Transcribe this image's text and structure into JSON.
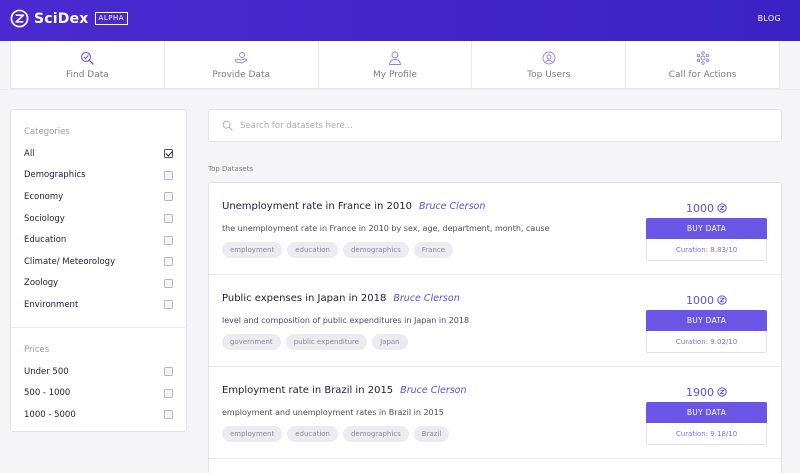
{
  "brand": {
    "name": "SciDex",
    "badge": "ALPHA"
  },
  "header": {
    "blog_link": "BLOG"
  },
  "nav": {
    "items": [
      {
        "label": "Find Data",
        "icon": "find-data-icon"
      },
      {
        "label": "Provide Data",
        "icon": "provide-data-icon"
      },
      {
        "label": "My Profile",
        "icon": "profile-icon"
      },
      {
        "label": "Top Users",
        "icon": "top-users-icon"
      },
      {
        "label": "Call for Actions",
        "icon": "call-for-actions-icon"
      }
    ]
  },
  "sidebar": {
    "categories": {
      "heading": "Categories",
      "items": [
        {
          "label": "All",
          "checked": true
        },
        {
          "label": "Demographics",
          "checked": false
        },
        {
          "label": "Economy",
          "checked": false
        },
        {
          "label": "Sociology",
          "checked": false
        },
        {
          "label": "Education",
          "checked": false
        },
        {
          "label": "Climate/ Meteorology",
          "checked": false
        },
        {
          "label": "Zoology",
          "checked": false
        },
        {
          "label": "Environment",
          "checked": false
        }
      ]
    },
    "prices": {
      "heading": "Prices",
      "items": [
        {
          "label": "Under 500",
          "checked": false
        },
        {
          "label": "500 - 1000",
          "checked": false
        },
        {
          "label": "1000 - 5000",
          "checked": false
        }
      ]
    }
  },
  "search": {
    "placeholder": "Search for datasets here...",
    "value": ""
  },
  "main": {
    "section_title": "Top Datasets"
  },
  "datasets": [
    {
      "title": "Unemployment rate in France in 2010",
      "author": "Bruce Clerson",
      "description": "the unemployment rate in France in 2010 by sex, age, department, month, cause",
      "tags": [
        "employment",
        "education",
        "demographics",
        "France"
      ],
      "price": "1000",
      "buy_label": "BUY DATA",
      "curation": "Curation: 8.83/10"
    },
    {
      "title": "Public expenses in Japan in 2018",
      "author": "Bruce Clerson",
      "description": "level and composition of public expenditures in Japan in 2018",
      "tags": [
        "government",
        "public expenditure",
        "Japan"
      ],
      "price": "1000",
      "buy_label": "BUY DATA",
      "curation": "Curation: 9.02/10"
    },
    {
      "title": "Employment rate in Brazil in 2015",
      "author": "Bruce Clerson",
      "description": "employment and unemployment rates in Brazil in 2015",
      "tags": [
        "employment",
        "education",
        "demographics",
        "Brazil"
      ],
      "price": "1900",
      "buy_label": "BUY DATA",
      "curation": "Curation: 9.18/10"
    }
  ],
  "colors": {
    "header": "#4a2ad0",
    "accent": "#6a55e6",
    "link": "#5b4ee0"
  }
}
